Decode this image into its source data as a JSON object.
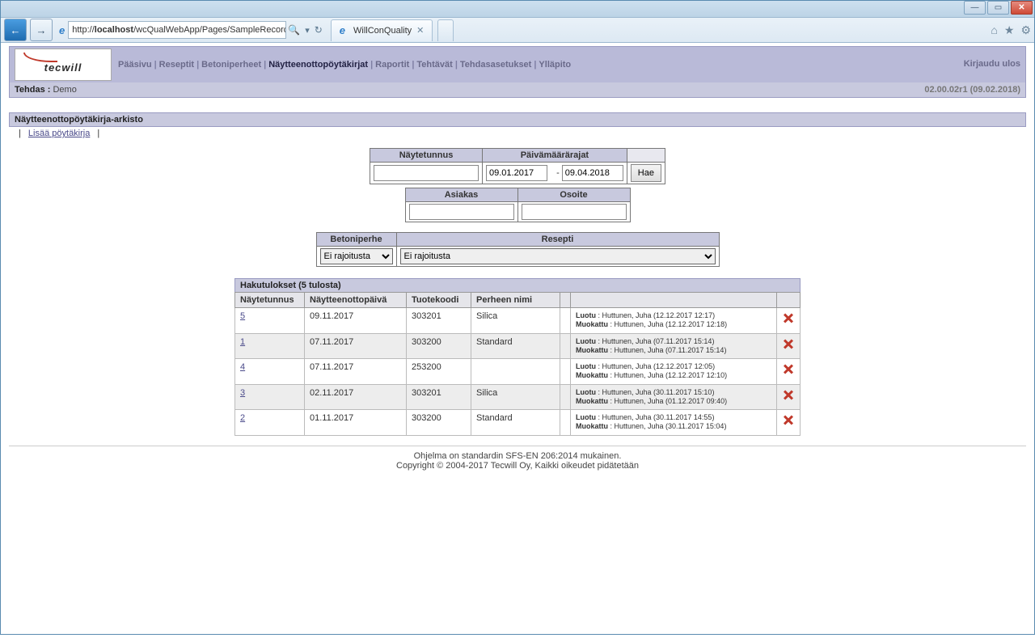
{
  "browser": {
    "url_prefix": "http://",
    "url_host": "localhost",
    "url_path": "/wcQualWebApp/Pages/SampleRecordManage",
    "tab_title": "WillConQuality"
  },
  "logo_text": "tecwill",
  "nav": {
    "paasivu": "Pääsivu",
    "reseptit": "Reseptit",
    "betoniperheet": "Betoniperheet",
    "naytteenotto": "Näytteenottopöytäkirjat",
    "raportit": "Raportit",
    "tehtavat": "Tehtävät",
    "tehdasasetukset": "Tehdasasetukset",
    "yllapito": "Ylläpito",
    "logout": "Kirjaudu ulos"
  },
  "factory_label": "Tehdas :",
  "factory_value": "Demo",
  "version": "02.00.02r1 (09.02.2018)",
  "section_title": "Näytteenottopöytäkirja-arkisto",
  "sublink_add": "Lisää pöytäkirja",
  "filters": {
    "sample_id_label": "Näytetunnus",
    "date_range_label": "Päivämäärärajat",
    "date_from": "09.01.2017",
    "date_to": "09.04.2018",
    "search_btn": "Hae",
    "customer_label": "Asiakas",
    "address_label": "Osoite",
    "family_label": "Betoniperhe",
    "recipe_label": "Resepti",
    "no_restriction": "Ei rajoitusta"
  },
  "results_title": "Hakutulokset  (5 tulosta)",
  "columns": {
    "id": "Näytetunnus",
    "date": "Näytteenottopäivä",
    "product": "Tuotekoodi",
    "family": "Perheen nimi"
  },
  "meta_labels": {
    "created": "Luotu",
    "modified": "Muokattu"
  },
  "rows": [
    {
      "id": "5",
      "date": "09.11.2017",
      "product": "303201",
      "family": "Silica",
      "created": "Huttunen, Juha (12.12.2017 12:17)",
      "modified": "Huttunen, Juha (12.12.2017 12:18)"
    },
    {
      "id": "1",
      "date": "07.11.2017",
      "product": "303200",
      "family": "Standard",
      "created": "Huttunen, Juha (07.11.2017 15:14)",
      "modified": "Huttunen, Juha (07.11.2017 15:14)"
    },
    {
      "id": "4",
      "date": "07.11.2017",
      "product": "253200",
      "family": "",
      "created": "Huttunen, Juha (12.12.2017 12:05)",
      "modified": "Huttunen, Juha (12.12.2017 12:10)"
    },
    {
      "id": "3",
      "date": "02.11.2017",
      "product": "303201",
      "family": "Silica",
      "created": "Huttunen, Juha (30.11.2017 15:10)",
      "modified": "Huttunen, Juha (01.12.2017 09:40)"
    },
    {
      "id": "2",
      "date": "01.11.2017",
      "product": "303200",
      "family": "Standard",
      "created": "Huttunen, Juha (30.11.2017 14:55)",
      "modified": "Huttunen, Juha (30.11.2017 15:04)"
    }
  ],
  "footer": {
    "line1": "Ohjelma on standardin SFS-EN 206:2014 mukainen.",
    "line2": "Copyright © 2004-2017 Tecwill Oy, Kaikki oikeudet pidätetään"
  }
}
